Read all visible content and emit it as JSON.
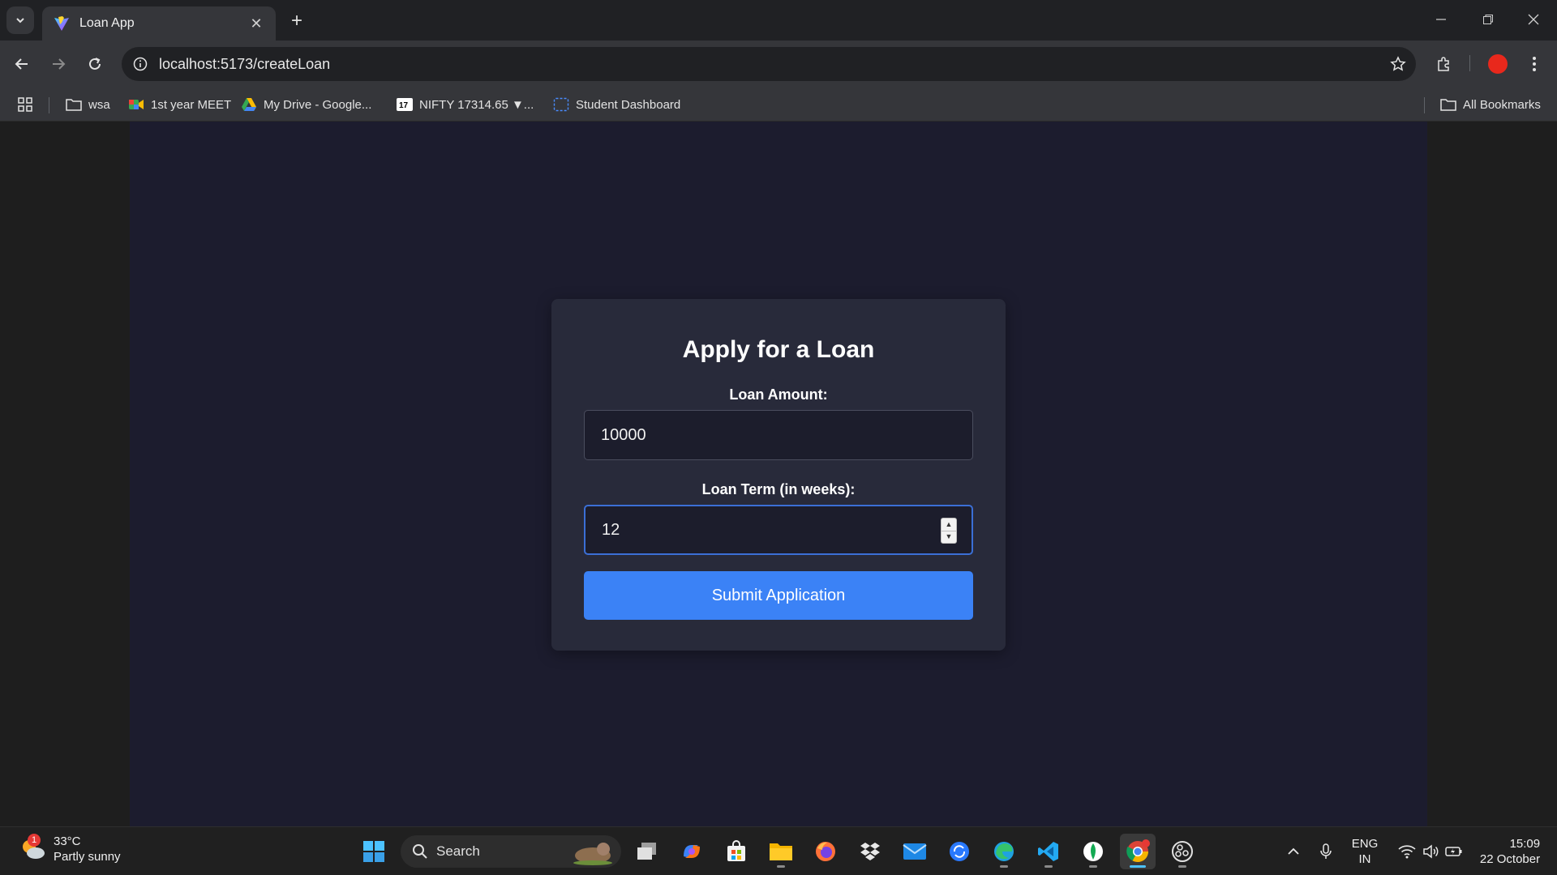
{
  "browser": {
    "tab_title": "Loan App",
    "url": "localhost:5173/createLoan",
    "bookmarks": [
      {
        "label": "wsa",
        "icon": "folder-icon"
      },
      {
        "label": "1st year MEET",
        "icon": "meet-icon"
      },
      {
        "label": "My Drive - Google...",
        "icon": "drive-icon"
      },
      {
        "label": "NIFTY 17314.65 ▼...",
        "icon": "tradingview-icon"
      },
      {
        "label": "Student Dashboard",
        "icon": "dashboard-icon"
      }
    ],
    "all_bookmarks_label": "All Bookmarks"
  },
  "loan_form": {
    "title": "Apply for a Loan",
    "amount_label": "Loan Amount:",
    "amount_value": "10000",
    "term_label": "Loan Term (in weeks):",
    "term_value": "12",
    "submit_label": "Submit Application"
  },
  "taskbar": {
    "weather_temp": "33°C",
    "weather_desc": "Partly sunny",
    "weather_badge": "1",
    "search_label": "Search",
    "lang_top": "ENG",
    "lang_bottom": "IN",
    "time": "15:09",
    "date": "22 October"
  },
  "colors": {
    "accent": "#3b82f6",
    "page_bg": "#1c1c2e",
    "card_bg": "#282a3a"
  }
}
